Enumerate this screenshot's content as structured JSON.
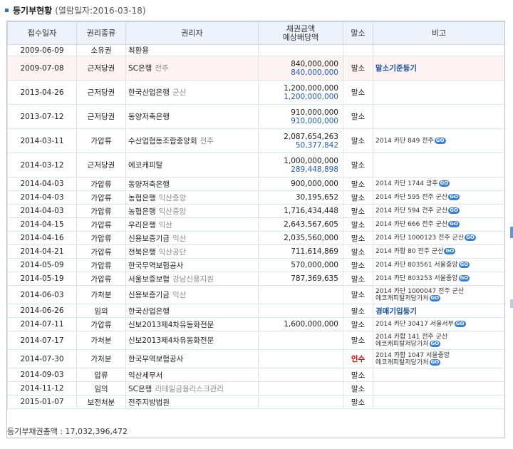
{
  "header": {
    "title": "등기부현황",
    "subtitle": "(열람일자:2016-03-18)"
  },
  "table": {
    "columns": [
      "접수일자",
      "권리종류",
      "권리자",
      "채권금액",
      "예상배당액",
      "말소",
      "비고"
    ],
    "rows": [
      {
        "date": "2009-06-09",
        "type": "소유권",
        "holder": "최환용",
        "holder_sub": "",
        "amount": "",
        "amount2": "",
        "cancel": "",
        "note": "",
        "note_link": false,
        "go": false
      },
      {
        "date": "2009-07-08",
        "type": "근저당권",
        "holder": "SC은행",
        "holder_sub": "전주",
        "amount": "840,000,000",
        "amount2": "840,000,000",
        "cancel": "말소",
        "note": "말소기준등기",
        "note_link": true,
        "go": false
      },
      {
        "date": "2013-04-26",
        "type": "근저당권",
        "holder": "한국산업은행",
        "holder_sub": "군산",
        "amount": "1,200,000,000",
        "amount2": "1,200,000,000",
        "cancel": "말소",
        "note": "",
        "note_link": false,
        "go": false
      },
      {
        "date": "2013-07-12",
        "type": "근저당권",
        "holder": "동양저축은행",
        "holder_sub": "",
        "amount": "910,000,000",
        "amount2": "910,000,000",
        "cancel": "말소",
        "note": "",
        "note_link": false,
        "go": false
      },
      {
        "date": "2014-03-11",
        "type": "가압류",
        "holder": "수산업협동조합중앙회",
        "holder_sub": "전주",
        "amount": "2,087,654,263",
        "amount2": "50,377,842",
        "cancel": "말소",
        "note": "2014 카단 849 전주",
        "note_link": false,
        "go": true
      },
      {
        "date": "2014-03-12",
        "type": "근저당권",
        "holder": "에코캐피탈",
        "holder_sub": "",
        "amount": "1,000,000,000",
        "amount2": "289,448,898",
        "cancel": "말소",
        "note": "",
        "note_link": false,
        "go": false
      },
      {
        "date": "2014-04-03",
        "type": "가압류",
        "holder": "동양저축은행",
        "holder_sub": "",
        "amount": "900,000,000",
        "amount2": "",
        "cancel": "말소",
        "note": "2014 카단 1744 광주",
        "note_link": false,
        "go": true
      },
      {
        "date": "2014-04-03",
        "type": "가압류",
        "holder": "농협은행",
        "holder_sub": "익산중앙",
        "amount": "30,195,652",
        "amount2": "",
        "cancel": "말소",
        "note": "2014 카단 595 전주 군산",
        "note_link": false,
        "go": true
      },
      {
        "date": "2014-04-03",
        "type": "가압류",
        "holder": "농협은행",
        "holder_sub": "익산중앙",
        "amount": "1,716,434,448",
        "amount2": "",
        "cancel": "말소",
        "note": "2014 카단 594 전주 군산",
        "note_link": false,
        "go": true
      },
      {
        "date": "2014-04-15",
        "type": "가압류",
        "holder": "우리은행",
        "holder_sub": "익산",
        "amount": "2,643,567,605",
        "amount2": "",
        "cancel": "말소",
        "note": "2014 카단 666 전주 군산",
        "note_link": false,
        "go": true
      },
      {
        "date": "2014-04-16",
        "type": "가압류",
        "holder": "신용보증기금",
        "holder_sub": "익산",
        "amount": "2,035,560,000",
        "amount2": "",
        "cancel": "말소",
        "note": "2014 카단 1000123 전주 군산",
        "note_link": false,
        "go": true
      },
      {
        "date": "2014-04-21",
        "type": "가압류",
        "holder": "전북은행",
        "holder_sub": "익산공단",
        "amount": "711,614,869",
        "amount2": "",
        "cancel": "말소",
        "note": "2014 카합 80 전주 군산",
        "note_link": false,
        "go": true
      },
      {
        "date": "2014-05-09",
        "type": "가압류",
        "holder": "한국무역보험공사",
        "holder_sub": "",
        "amount": "570,000,000",
        "amount2": "",
        "cancel": "말소",
        "note": "2014 카단 803561 서울중앙",
        "note_link": false,
        "go": true
      },
      {
        "date": "2014-05-19",
        "type": "가압류",
        "holder": "서울보증보험",
        "holder_sub": "강남신용지원",
        "amount": "787,369,635",
        "amount2": "",
        "cancel": "말소",
        "note": "2014 카단 803253 서울중앙",
        "note_link": false,
        "go": true
      },
      {
        "date": "2014-06-03",
        "type": "가처분",
        "holder": "신용보증기금",
        "holder_sub": "익산",
        "amount": "",
        "amount2": "",
        "cancel": "말소",
        "note": "2014 카단 1000047 전주 군산 에코캐피탈저당가처",
        "note_link": false,
        "go": true
      },
      {
        "date": "2014-06-26",
        "type": "임의",
        "holder": "한국산업은행",
        "holder_sub": "",
        "amount": "",
        "amount2": "",
        "cancel": "말소",
        "note": "경매기입등기",
        "note_link": true,
        "go": false
      },
      {
        "date": "2014-07-11",
        "type": "가압류",
        "holder": "신보2013제4차유동화전문",
        "holder_sub": "",
        "amount": "1,600,000,000",
        "amount2": "",
        "cancel": "말소",
        "note": "2014 카단 30417 서울서부",
        "note_link": false,
        "go": true
      },
      {
        "date": "2014-07-17",
        "type": "가처분",
        "holder": "신보2013제4차유동화전문",
        "holder_sub": "",
        "amount": "",
        "amount2": "",
        "cancel": "말소",
        "note": "2014 카합 141 전주 군산 에코캐피탈저당가처",
        "note_link": false,
        "go": true
      },
      {
        "date": "2014-07-30",
        "type": "가처분",
        "holder": "한국무역보험공사",
        "holder_sub": "",
        "amount": "",
        "amount2": "",
        "cancel": "인수",
        "note": "2014 카합 1047 서울중앙 에코캐피탈저당가처",
        "note_link": false,
        "go": true
      },
      {
        "date": "2014-09-03",
        "type": "압류",
        "holder": "익산세무서",
        "holder_sub": "",
        "amount": "",
        "amount2": "",
        "cancel": "말소",
        "note": "",
        "note_link": false,
        "go": false
      },
      {
        "date": "2014-11-12",
        "type": "임의",
        "holder": "SC은행",
        "holder_sub": "리테일금융리스크관리",
        "amount": "",
        "amount2": "",
        "cancel": "말소",
        "note": "",
        "note_link": false,
        "go": false
      },
      {
        "date": "2015-01-07",
        "type": "보전처분",
        "holder": "전주지방법원",
        "holder_sub": "",
        "amount": "",
        "amount2": "",
        "cancel": "말소",
        "note": "",
        "note_link": false,
        "go": false
      }
    ]
  },
  "go_label": "GO",
  "footer": {
    "text": "등기부채권총액 : 17,032,396,472"
  }
}
